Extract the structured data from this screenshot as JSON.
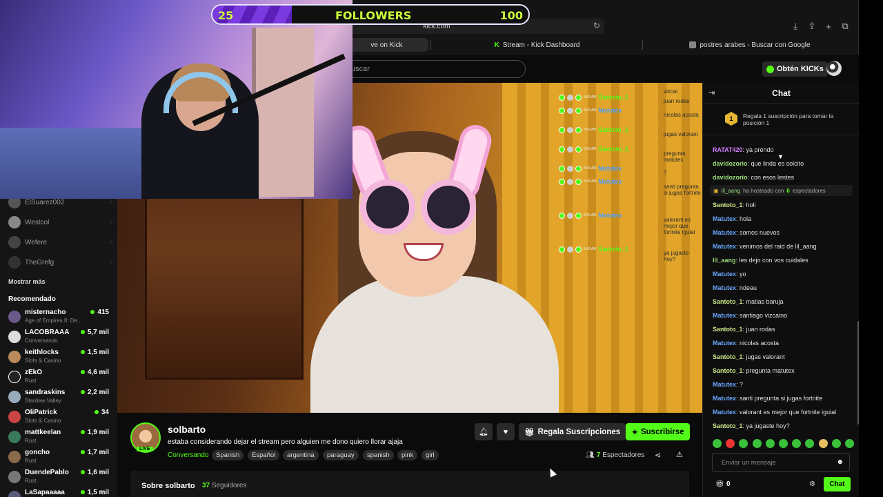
{
  "browser": {
    "url": "kick.com",
    "tabs": [
      {
        "label": "ve on Kick"
      },
      {
        "label": "Stream - Kick Dashboard"
      },
      {
        "label": "postres arabes - Buscar con Google"
      }
    ]
  },
  "header": {
    "search_placeholder": "uscar",
    "get_kicks_label": "Obtén KICKs"
  },
  "overlay": {
    "followers_current": "25",
    "followers_label": "FOLLOWERS",
    "followers_goal": "100",
    "progress_fraction": 0.25
  },
  "sidebar": {
    "following": [
      {
        "name": "ElSuarez002"
      },
      {
        "name": "Westcol"
      },
      {
        "name": "Wefere"
      },
      {
        "name": "TheGrefg"
      }
    ],
    "show_more": "Mostrar más",
    "recommended_title": "Recomendado",
    "recommended": [
      {
        "name": "misternacho",
        "category": "Age of Empires II: De...",
        "viewers": "415"
      },
      {
        "name": "LACOBRAAA",
        "category": "Conversando",
        "viewers": "5,7 mil"
      },
      {
        "name": "keithlocks",
        "category": "Slots & Casino",
        "viewers": "1,5 mil"
      },
      {
        "name": "zEkO",
        "category": "Rust",
        "viewers": "4,6 mil"
      },
      {
        "name": "sandraskins",
        "category": "Stardew Valley",
        "viewers": "2,2 mil"
      },
      {
        "name": "OliPatrick",
        "category": "Slots & Casino",
        "viewers": "34"
      },
      {
        "name": "mattkeelan",
        "category": "Rust",
        "viewers": "1,9 mil"
      },
      {
        "name": "goncho",
        "category": "Rust",
        "viewers": "1,7 mil"
      },
      {
        "name": "DuendePablo",
        "category": "Rust",
        "viewers": "1,6 mil"
      },
      {
        "name": "LaSapaaaaa",
        "category": "",
        "viewers": "1,5 mil"
      }
    ]
  },
  "video_overlay_chat": {
    "rows": [
      {
        "time": "8:05 AM",
        "user": "Santoto_1",
        "color": "#53fc18"
      },
      {
        "time": "8:06 AM",
        "user": "Matutex",
        "color": "#4a9eff"
      },
      {
        "time": "8:06 AM",
        "user": "Santoto_1",
        "color": "#53fc18"
      },
      {
        "time": "8:06 AM",
        "user": "Santoto_1",
        "color": "#53fc18"
      },
      {
        "time": "8:06 AM",
        "user": "Matutex",
        "color": "#4a9eff"
      },
      {
        "time": "8:06 AM",
        "user": "Matutex",
        "color": "#4a9eff"
      },
      {
        "time": "8:06 AM",
        "user": "Matutex",
        "color": "#4a9eff"
      },
      {
        "time": "8:06 AM",
        "user": "Santoto_1",
        "color": "#53fc18"
      }
    ],
    "messages": [
      "vizcai",
      "juan rodas",
      "nicolas acosta",
      "jugas valorant",
      "pregunta matutex",
      "?",
      "santi pregunta si jugas fortnite",
      "valorant es mejor que fortnite iguial",
      "ya jugaste hoy?"
    ]
  },
  "stream": {
    "streamer": "solbarto",
    "live_label": "LIVE",
    "title": "estaba considerando dejar el stream pero alguien me dono quiero llorar ajaja",
    "category": "Conversando",
    "tags": [
      "Spanish",
      "Español",
      "argentina",
      "paraguay",
      "spanish",
      "pink",
      "girl"
    ],
    "gift_label": "Regala Suscripciones",
    "subscribe_label": "Suscribirse",
    "viewers_count": "7",
    "viewers_label": "Espectadores",
    "about_title": "Sobre solbarto",
    "followers_count": "37",
    "followers_label": "Seguidores"
  },
  "chat": {
    "title": "Chat",
    "promo_rank": "1",
    "promo_text": "Regala 1 suscripción para tomar la posición 1",
    "host": {
      "user": "lil_aang",
      "text_before": "ha hosteado con",
      "count": "6",
      "text_after": "espectadores"
    },
    "messages": [
      {
        "user": "RATAT420",
        "text": "ya prendo",
        "color": "#d47cff"
      },
      {
        "user": "davidozorio",
        "text": "que linda es solcito",
        "color": "#9cdc7a"
      },
      {
        "user": "davidozorio",
        "text": "con esos lentes",
        "color": "#9cdc7a"
      },
      {
        "user": "Santoto_1",
        "text": "holi",
        "color": "#cfe88a"
      },
      {
        "user": "Matutex",
        "text": "hola",
        "color": "#6aa8ff"
      },
      {
        "user": "Matutex",
        "text": "somos nuevos",
        "color": "#6aa8ff"
      },
      {
        "user": "Matutex",
        "text": "venimos del raid de lil_aang",
        "color": "#6aa8ff"
      },
      {
        "user": "lil_aang",
        "text": "les dejo con vos cuidales",
        "color": "#9cdc7a"
      },
      {
        "user": "Matutex",
        "text": "yo",
        "color": "#6aa8ff"
      },
      {
        "user": "Matutex",
        "text": "ndeau",
        "color": "#6aa8ff"
      },
      {
        "user": "Santoto_1",
        "text": "matias baruja",
        "color": "#cfe88a"
      },
      {
        "user": "Matutex",
        "text": "santiago vizcaino",
        "color": "#6aa8ff"
      },
      {
        "user": "Santoto_1",
        "text": "juan rodas",
        "color": "#cfe88a"
      },
      {
        "user": "Matutex",
        "text": "nicolas acosta",
        "color": "#6aa8ff"
      },
      {
        "user": "Santoto_1",
        "text": "jugas valorant",
        "color": "#cfe88a"
      },
      {
        "user": "Santoto_1",
        "text": "pregunta matutex",
        "color": "#cfe88a"
      },
      {
        "user": "Matutex",
        "text": "?",
        "color": "#6aa8ff"
      },
      {
        "user": "Matutex",
        "text": "santi pregunta si jugas fortnite",
        "color": "#6aa8ff"
      },
      {
        "user": "Matutex",
        "text": "valorant es mejor que fortnite iguial",
        "color": "#6aa8ff"
      },
      {
        "user": "Santoto_1",
        "text": "ya jugaste hoy?",
        "color": "#cfe88a"
      }
    ],
    "input_placeholder": "Enviar un mensaje",
    "gift_count": "0",
    "send_label": "Chat"
  },
  "colors": {
    "kick_green": "#53fc18",
    "followers_bar_text": "#c9ff3a",
    "followers_bar_fill": "#7a3ae0"
  }
}
